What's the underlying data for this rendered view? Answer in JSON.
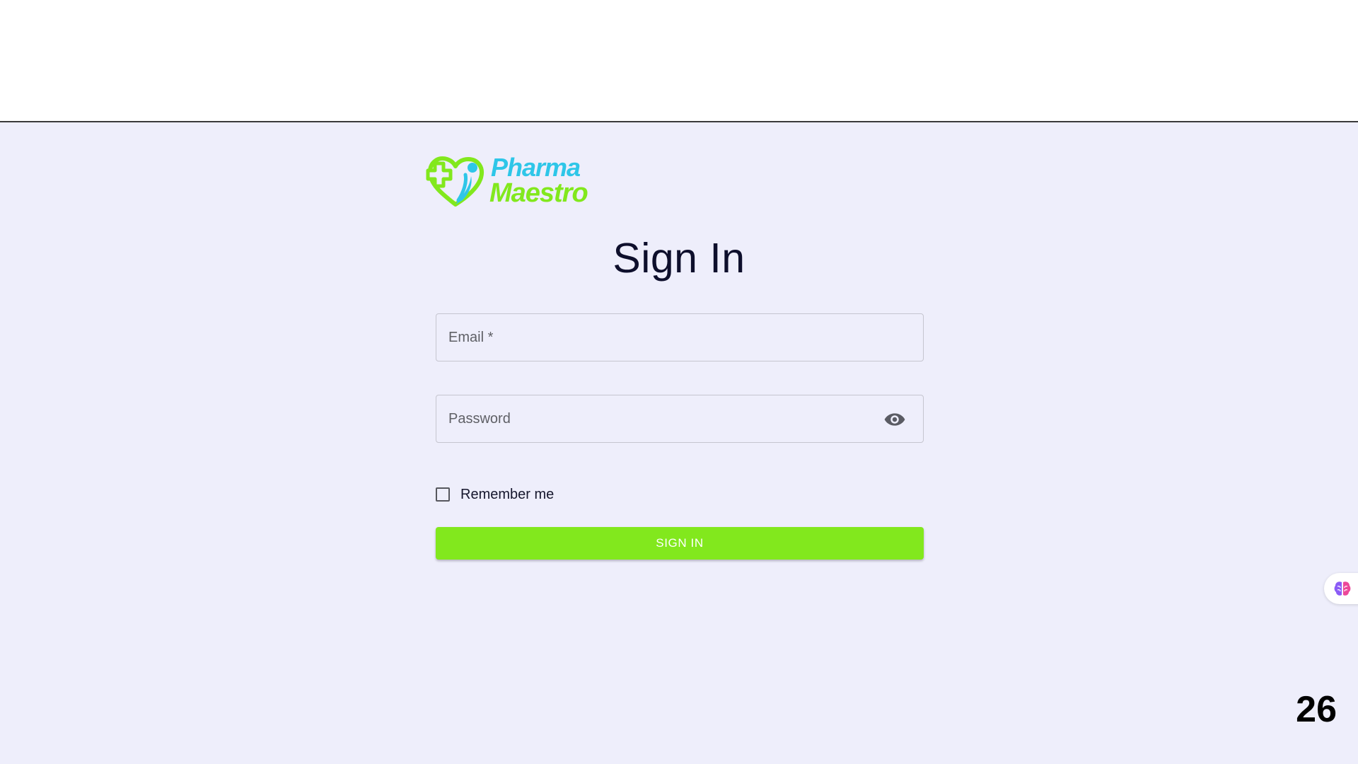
{
  "brand": {
    "name_line1": "Pharma",
    "name_line2": "Maestro",
    "green": "#82e81d",
    "blue": "#2ec6e8"
  },
  "signin": {
    "title": "Sign In",
    "email_placeholder": "Email *",
    "email_value": "",
    "password_placeholder": "Password",
    "password_value": "",
    "password_toggle_icon": "eye-icon",
    "remember_label": "Remember me",
    "remember_checked": false,
    "submit_label": "SIGN IN"
  },
  "colors": {
    "page_background": "#eeeefb",
    "title_text": "#0e0f2c",
    "button_background": "#82e81d",
    "button_text": "#ffffff"
  },
  "floating_widget": {
    "icon": "brain-icon"
  },
  "slide_number": "26"
}
